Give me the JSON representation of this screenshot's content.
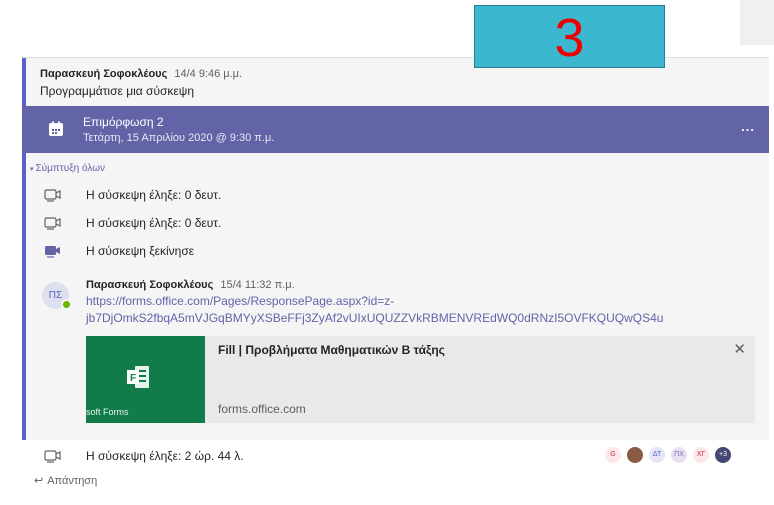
{
  "post": {
    "author": "Παρασκευή Σοφοκλέους",
    "time": "14/4 9:46 μ.μ.",
    "body": "Προγραμμάτισε μια σύσκεψη"
  },
  "meeting": {
    "title": "Επιμόρφωση 2",
    "subtitle": "Τετάρτη, 15 Απριλίου 2020 @ 9:30 π.μ.",
    "more_label": "...",
    "bar_color": "#6264a7"
  },
  "collapse_label": "Σύμπτυξη όλων",
  "events": [
    {
      "icon": "meeting-ended-icon",
      "text": "Η σύσκεψη έληξε: 0 δευτ."
    },
    {
      "icon": "meeting-ended-icon",
      "text": "Η σύσκεψη έληξε: 0 δευτ."
    },
    {
      "icon": "meeting-started-icon",
      "text": "Η σύσκεψη ξεκίνησε"
    }
  ],
  "reply_message": {
    "avatar_initials": "ΠΣ",
    "author": "Παρασκευή Σοφοκλέους",
    "time": "15/4 11:32 π.μ.",
    "link_line1": "https://forms.office.com/Pages/ResponsePage.aspx?id=z-",
    "link_line2": "jb7DjOmkS2fbqA5mVJGqBMYyXSBeFFj3ZyAf2vUIxUQUZZVkRBMENVREdWQ0dRNzI5OVFKQUQwQS4u"
  },
  "link_preview": {
    "title": "Fill | Προβλήματα Μαθηματικών Β τάξης",
    "domain": "forms.office.com",
    "thumb_caption": "soft Forms",
    "close_label": "✕",
    "thumb_color": "#117c4a"
  },
  "meeting_ended": {
    "text": "Η σύσκεψη έληξε: 2 ώρ. 44 λ.",
    "participants": [
      {
        "initials": "G",
        "bg": "#fde7e9",
        "fg": "#c4314b"
      },
      {
        "initials": "",
        "bg": "#8a5a44",
        "fg": "#ffffff"
      },
      {
        "initials": "ΔΤ",
        "bg": "#e3e6f5",
        "fg": "#5b5fc7"
      },
      {
        "initials": "ΠΧ",
        "bg": "#e8e0f0",
        "fg": "#8764b8"
      },
      {
        "initials": "ΧΓ",
        "bg": "#fde7e9",
        "fg": "#c4314b"
      },
      {
        "initials": "+3",
        "bg": "#464775",
        "fg": "#ffffff"
      }
    ]
  },
  "reply_label": "Απάντηση",
  "step_badge": "3"
}
